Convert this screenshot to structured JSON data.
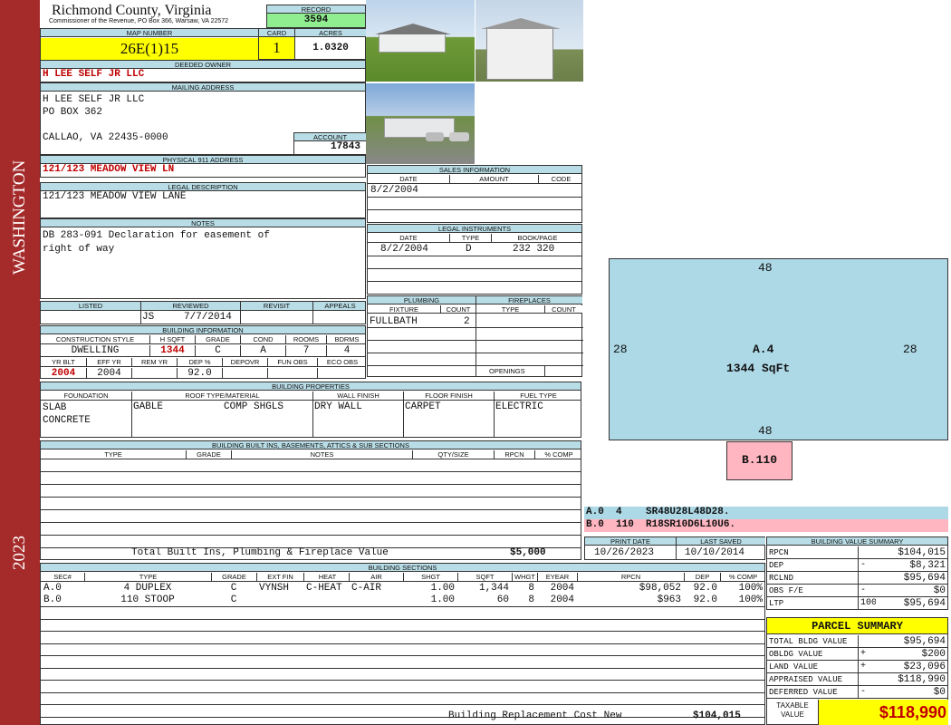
{
  "side": {
    "top_label": "WASHINGTON",
    "bottom_label": "2023"
  },
  "header": {
    "county": "Richmond County, Virginia",
    "commissioner": "Commissioner of the Revenue, PO Box 366, Warsaw, VA 22572",
    "record_label": "RECORD",
    "record": "3594",
    "map_label": "MAP NUMBER",
    "map": "26E(1)15",
    "card_label": "CARD",
    "card": "1",
    "acres_label": "ACRES",
    "acres": "1.0320"
  },
  "owner": {
    "label": "DEEDED OWNER",
    "name": "H LEE SELF JR LLC",
    "mail_label": "MAILING ADDRESS",
    "mail1": "H LEE SELF JR LLC",
    "mail2": "PO BOX 362",
    "mail3": "CALLAO, VA 22435-0000",
    "acct_label": "ACCOUNT",
    "account": "17843"
  },
  "phys": {
    "label": "PHYSICAL 911 ADDRESS",
    "value": "121/123 MEADOW VIEW LN"
  },
  "legal": {
    "label": "LEGAL DESCRIPTION",
    "value": "121/123 MEADOW VIEW LANE"
  },
  "notes": {
    "label": "NOTES",
    "line1": "DB 283-091 Declaration for easement of",
    "line2": "right of way"
  },
  "sales": {
    "label": "SALES INFORMATION",
    "h_date": "DATE",
    "h_amount": "AMOUNT",
    "h_code": "CODE",
    "date": "8/2/2004"
  },
  "instruments": {
    "label": "LEGAL INSTRUMENTS",
    "h_date": "DATE",
    "h_type": "TYPE",
    "h_book": "BOOK/PAGE",
    "date": "8/2/2004",
    "type": "D",
    "book": "232 320"
  },
  "review": {
    "h_listed": "LISTED",
    "h_reviewed": "REVIEWED",
    "h_revisit": "REVISIT",
    "h_appeals": "APPEALS",
    "reviewer": "JS",
    "rev_date": "7/7/2014"
  },
  "plumbing": {
    "label": "PLUMBING",
    "h_fixture": "FIXTURE",
    "h_count": "COUNT",
    "fixture": "FULLBATH",
    "count": "2"
  },
  "fireplaces": {
    "label": "FIREPLACES",
    "h_type": "TYPE",
    "h_count": "COUNT",
    "openings": "OPENINGS"
  },
  "bldg_info": {
    "label": "BUILDING INFORMATION",
    "h_style": "CONSTRUCTION STYLE",
    "h_hsqft": "H SQFT",
    "h_grade": "GRADE",
    "h_cond": "COND",
    "h_rooms": "ROOMS",
    "h_bdrms": "BDRMS",
    "style": "DWELLING",
    "hsqft": "1344",
    "grade": "C",
    "cond": "A",
    "rooms": "7",
    "bdrms": "4",
    "h_yrblt": "YR BLT",
    "h_effyr": "EFF YR",
    "h_remyr": "REM YR",
    "h_dep": "DEP %",
    "h_depovr": "DEPOVR",
    "h_funobs": "FUN OBS",
    "h_ecoobs": "ECO OBS",
    "yrblt": "2004",
    "effyr": "2004",
    "dep": "92.0"
  },
  "props": {
    "label": "BUILDING PROPERTIES",
    "h_found": "FOUNDATION",
    "h_roof": "ROOF TYPE/MATERIAL",
    "h_wall": "WALL FINISH",
    "h_floor": "FLOOR FINISH",
    "h_fuel": "FUEL TYPE",
    "found1": "SLAB",
    "found2": "CONCRETE",
    "roof1": "GABLE",
    "roof2": "COMP SHGLS",
    "wall": "DRY WALL",
    "floor": "CARPET",
    "fuel": "ELECTRIC"
  },
  "builtins": {
    "label": "BUILDING BUILT INS, BASEMENTS, ATTICS & SUB SECTIONS",
    "h_type": "TYPE",
    "h_grade": "GRADE",
    "h_notes": "NOTES",
    "h_qty": "QTY/SIZE",
    "h_rpcn": "RPCN",
    "h_comp": "% COMP",
    "total_label": "Total Built Ins, Plumbing & Fireplace Value",
    "total": "$5,000"
  },
  "sketch": {
    "top": "48",
    "bottom": "48",
    "left": "28",
    "right": "28",
    "main_label": "A.4",
    "main_area": "1344 SqFt",
    "sub_label": "B.110",
    "legend_a": "A.0  4    SR48U28L48D28.",
    "legend_b": "B.0  110  R18SR10D6L10U6."
  },
  "dates": {
    "h_print": "PRINT DATE",
    "h_saved": "LAST SAVED",
    "print": "10/26/2023",
    "saved": "10/10/2014"
  },
  "sections": {
    "label": "BUILDING SECTIONS",
    "headers": [
      "SEC#",
      "TYPE",
      "GRADE",
      "EXT FIN",
      "HEAT",
      "AIR",
      "SHGT",
      "SQFT",
      "WHGT",
      "EYEAR",
      "RPCN",
      "DEP",
      "% COMP"
    ],
    "rows": [
      [
        "A.0",
        "4 DUPLEX",
        "C",
        "VYNSH",
        "C-HEAT",
        "C-AIR",
        "1.00",
        "1,344",
        "8",
        "2004",
        "$98,052",
        "92.0",
        "100%"
      ],
      [
        "B.0",
        "110 STOOP",
        "C",
        "",
        "",
        "",
        "1.00",
        "60",
        "8",
        "2004",
        "$963",
        "92.0",
        "100%"
      ]
    ],
    "brcn_label": "Building Replacement Cost New",
    "brcn": "$104,015"
  },
  "bvs": {
    "label": "BUILDING VALUE SUMMARY",
    "rows": [
      {
        "k": "RPCN",
        "s": "",
        "v": "$104,015"
      },
      {
        "k": "DEP",
        "s": "-",
        "v": "$8,321"
      },
      {
        "k": "RCLND",
        "s": "",
        "v": "$95,694"
      },
      {
        "k": "OBS F/E",
        "s": "-",
        "v": "$0"
      },
      {
        "k": "LTP",
        "s": "100%",
        "v": "$95,694"
      }
    ]
  },
  "parcel": {
    "label": "PARCEL SUMMARY",
    "rows": [
      {
        "k": "TOTAL BLDG VALUE",
        "s": "",
        "v": "$95,694"
      },
      {
        "k": "OBLDG VALUE",
        "s": "+",
        "v": "$200"
      },
      {
        "k": "LAND VALUE",
        "s": "+",
        "v": "$23,096"
      },
      {
        "k": "APPRAISED VALUE",
        "s": "",
        "v": "$118,990"
      },
      {
        "k": "DEFERRED VALUE",
        "s": "-",
        "v": "$0"
      }
    ],
    "taxable_label": "TAXABLE VALUE",
    "taxable": "$118,990"
  },
  "colors": {
    "side": "#a52a2a",
    "header": "#b9dde6",
    "highlight": "#ffff00",
    "green": "#90ee90",
    "sketch": "#add8e6",
    "pink": "#ffb6c1",
    "red": "#c00000"
  }
}
